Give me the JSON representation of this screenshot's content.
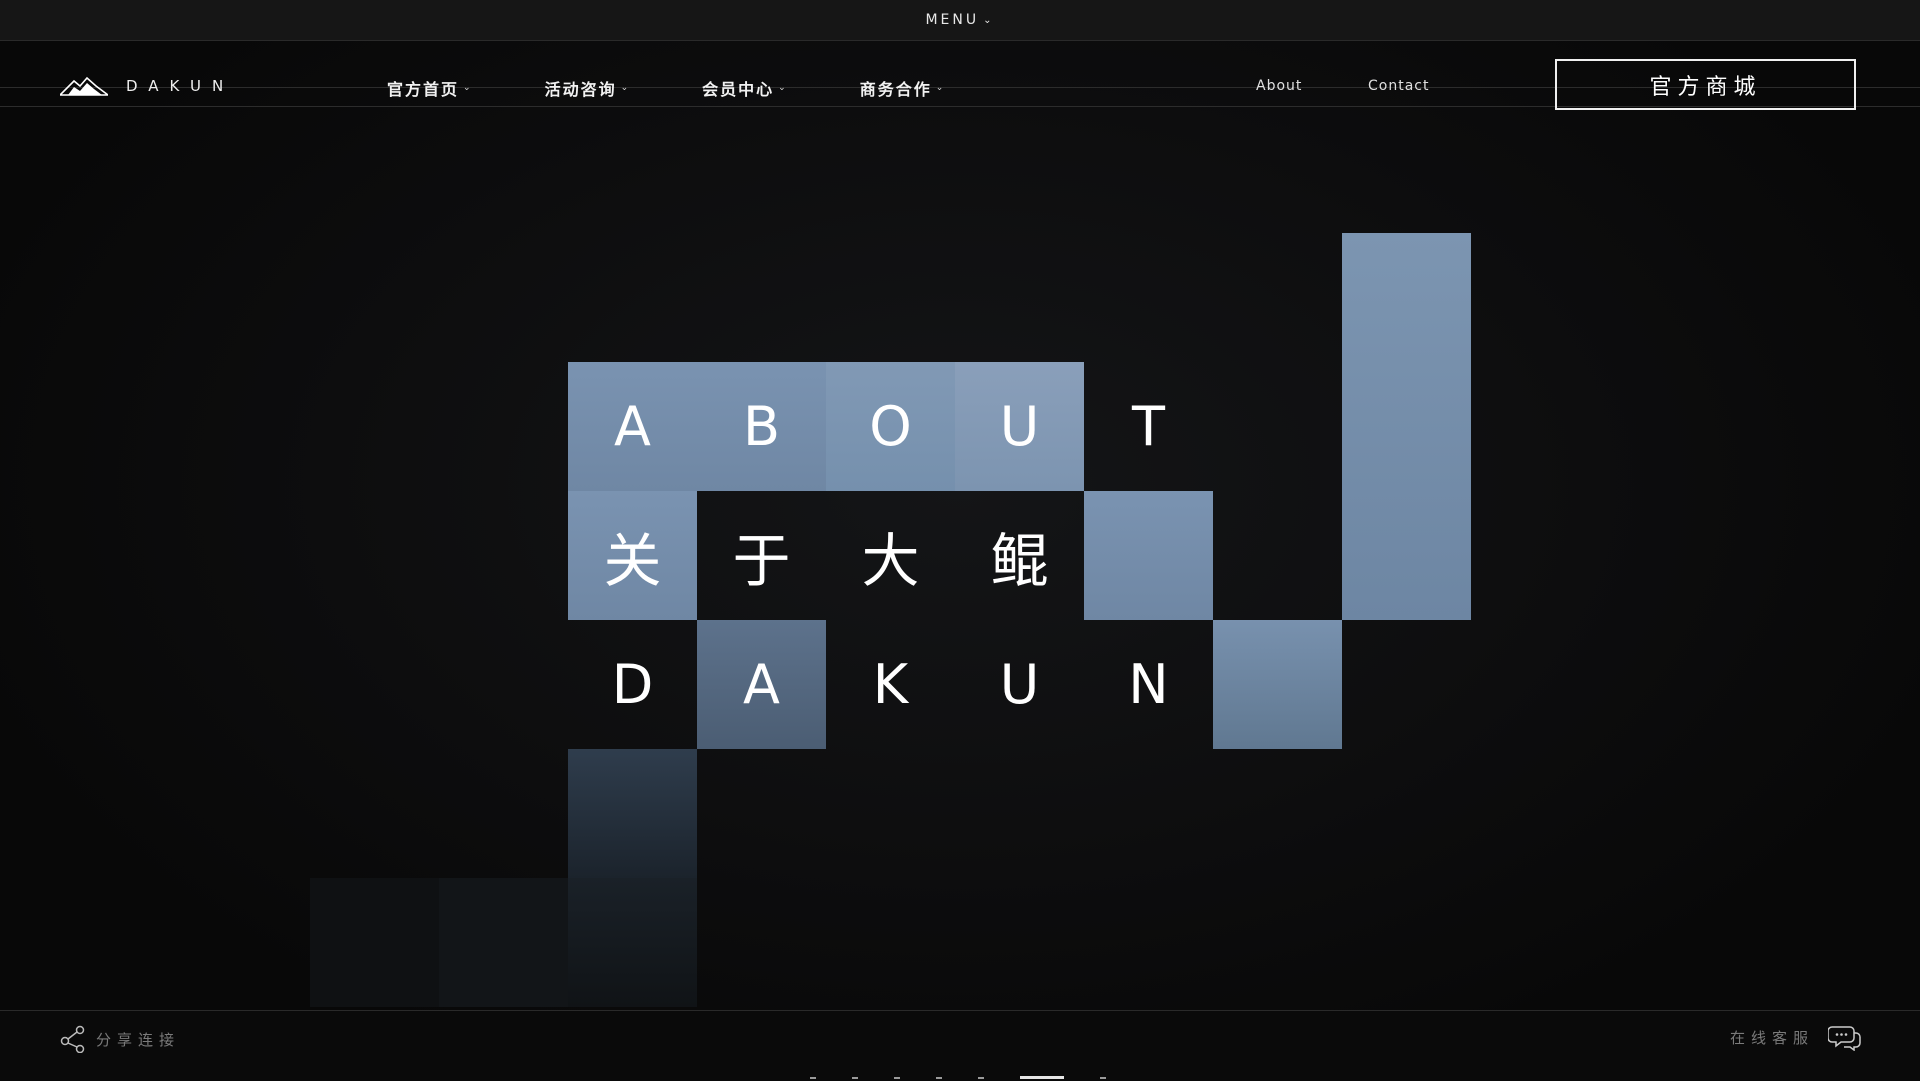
{
  "menu": {
    "label": "MENU",
    "icon": "chevron-down-icon"
  },
  "brand": {
    "name": "DAKUN",
    "logo_icon": "mountain-logo-icon"
  },
  "nav": [
    {
      "label": "官方首页"
    },
    {
      "label": "活动咨询"
    },
    {
      "label": "会员中心"
    },
    {
      "label": "商务合作"
    }
  ],
  "links": {
    "about": "About",
    "contact": "Contact"
  },
  "shop_button": "官方商城",
  "hero": {
    "row1": [
      "A",
      "B",
      "O",
      "U",
      "T"
    ],
    "row2": [
      "关",
      "于",
      "大",
      "鲲"
    ],
    "row3": [
      "D",
      "A",
      "K",
      "U",
      "N"
    ],
    "tile_color": "#7a93b1"
  },
  "footer": {
    "share_label": "分享连接",
    "share_icon": "share-icon",
    "service_label": "在线客服",
    "service_icon": "chat-bubble-icon"
  },
  "pager": {
    "count": 8,
    "active_index": 6
  }
}
